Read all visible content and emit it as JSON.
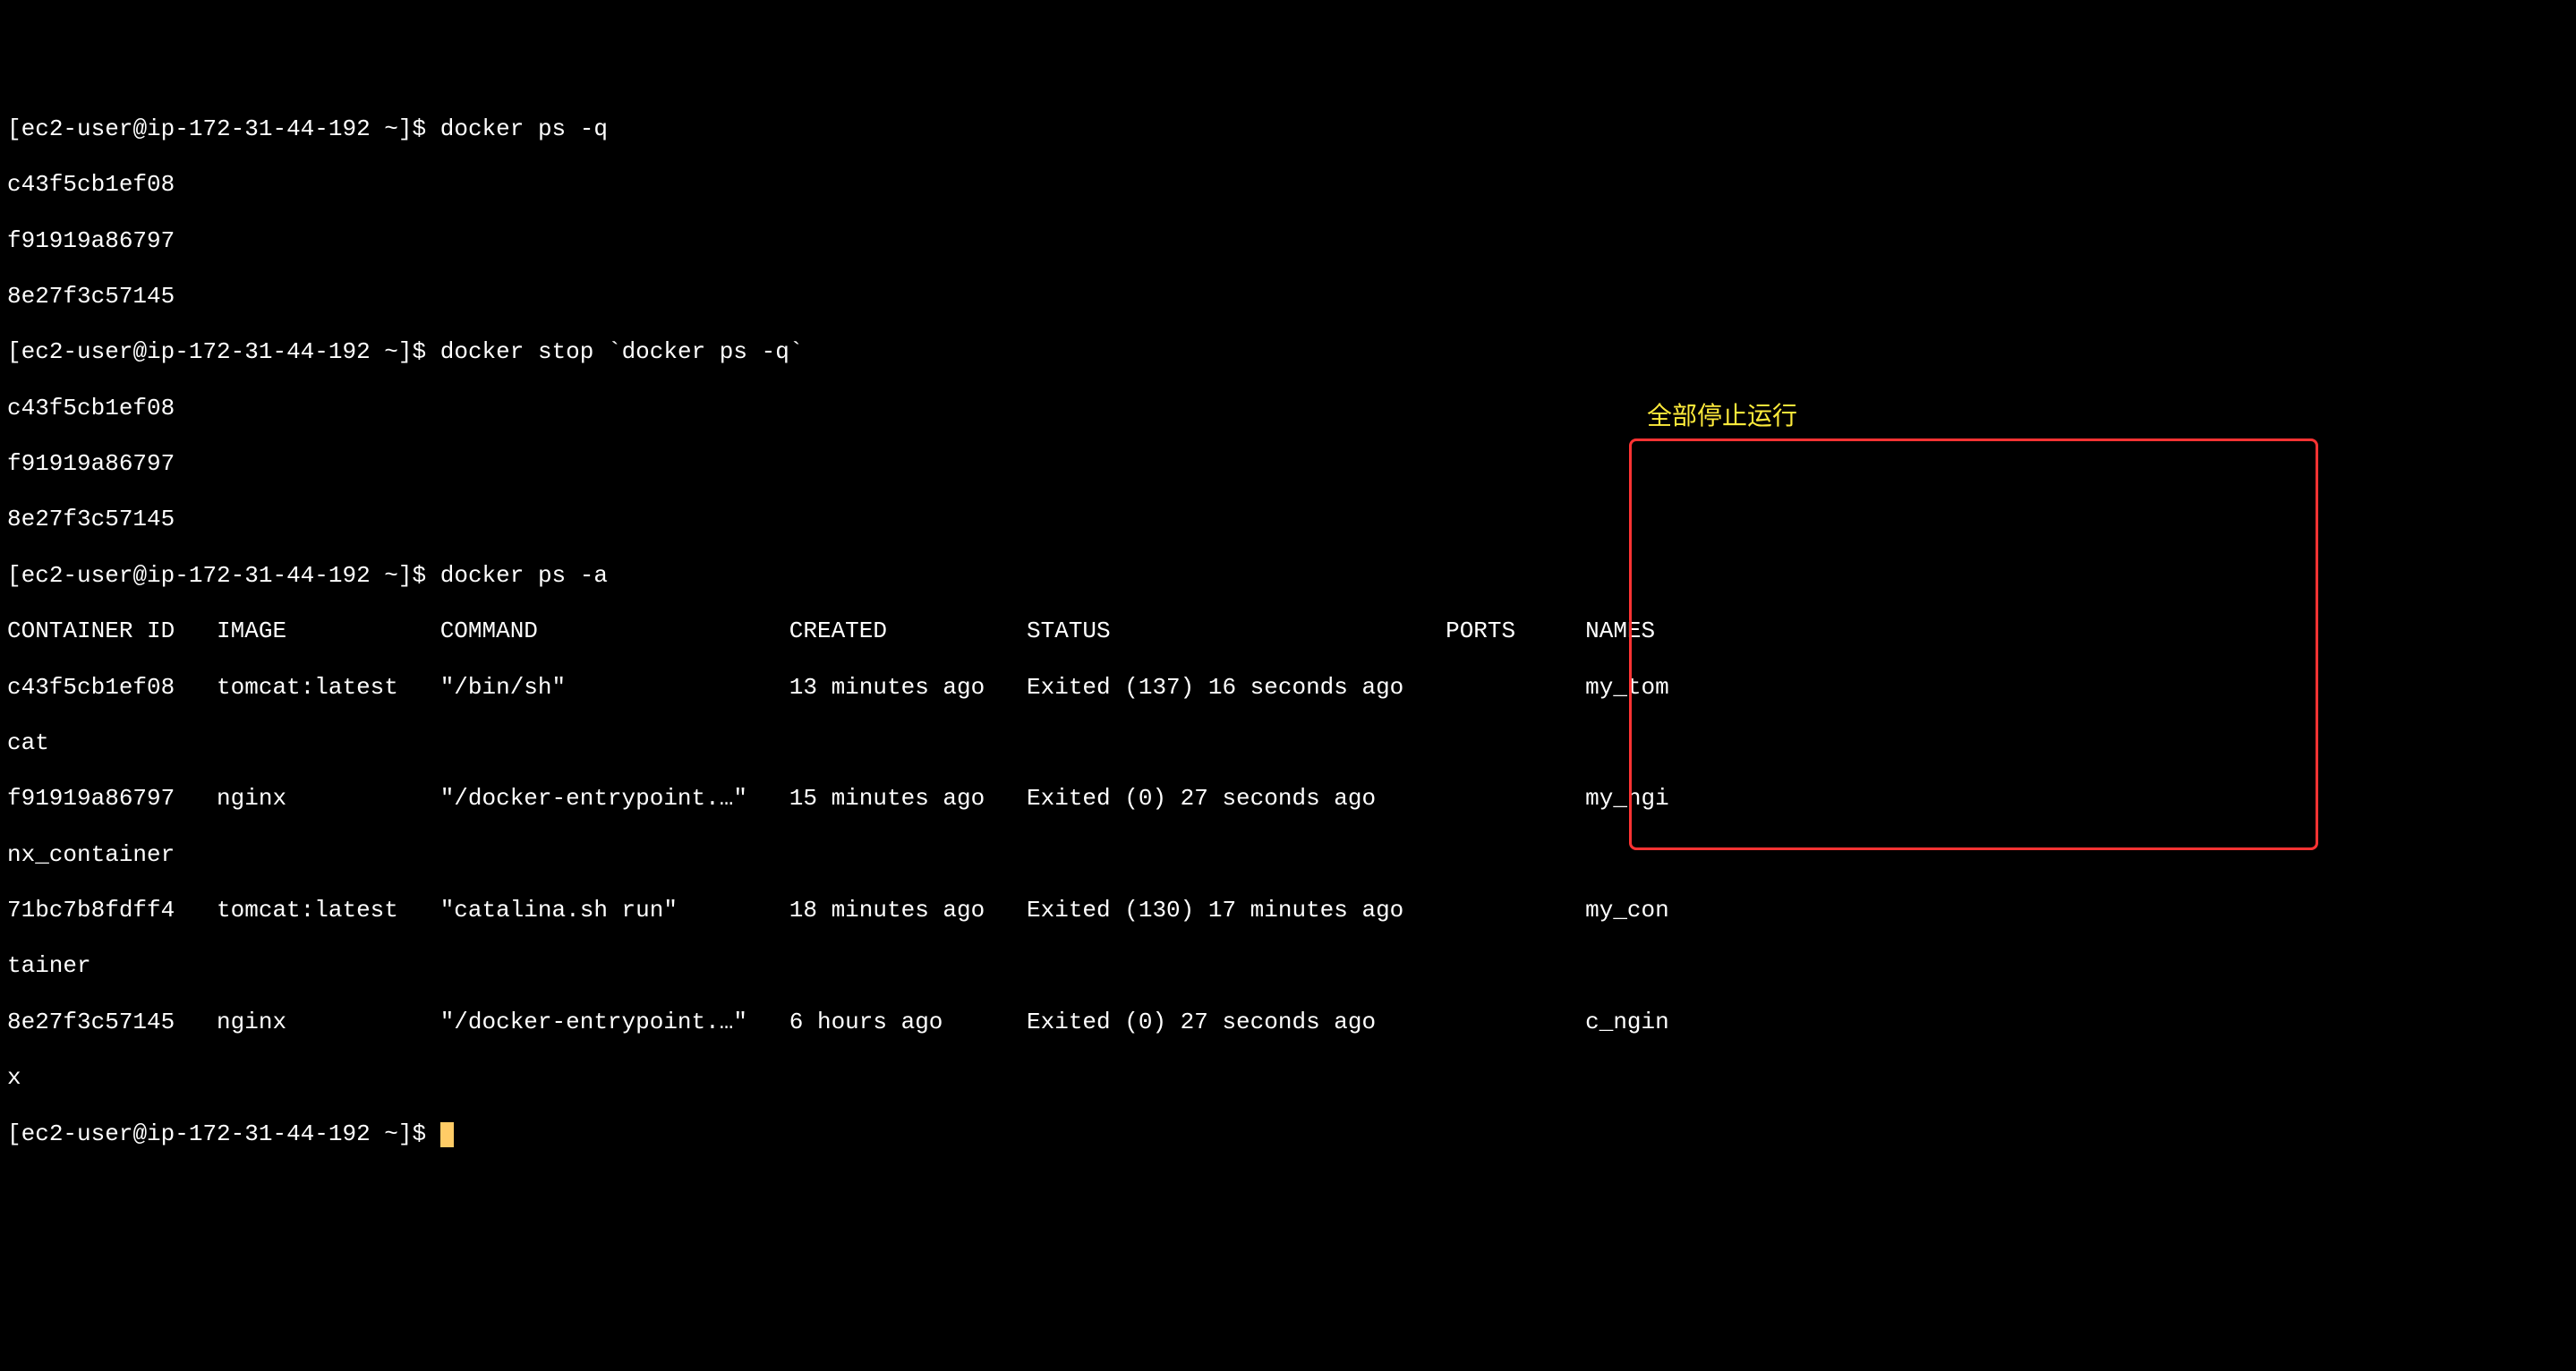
{
  "prompt": {
    "open": "[",
    "user": "ec2-user",
    "at": "@",
    "host": "ip-172-31-44-192",
    "path": " ~",
    "close": "]",
    "symbol": "$ "
  },
  "commands": {
    "cmd1": "docker ps -q",
    "cmd2": "docker stop `docker ps -q`",
    "cmd3": "docker ps -a",
    "cmd_empty": ""
  },
  "output1": {
    "line1": "c43f5cb1ef08",
    "line2": "f91919a86797",
    "line3": "8e27f3c57145"
  },
  "output2": {
    "line1": "c43f5cb1ef08",
    "line2": "f91919a86797",
    "line3": "8e27f3c57145"
  },
  "table": {
    "headers": {
      "container_id": "CONTAINER ID",
      "image": "IMAGE",
      "command": "COMMAND",
      "created": "CREATED",
      "status": "STATUS",
      "ports": "PORTS",
      "names": "NAMES"
    },
    "row1": {
      "container_id": "c43f5cb1ef08",
      "image": "tomcat:latest",
      "command": "\"/bin/sh\"",
      "created": "13 minutes ago",
      "status": "Exited (137) 16 seconds ago",
      "ports": "",
      "names_part1": "my_tom",
      "names_part2": "cat"
    },
    "row2": {
      "container_id": "f91919a86797",
      "image": "nginx",
      "command": "\"/docker-entrypoint.…\"",
      "created": "15 minutes ago",
      "status": "Exited (0) 27 seconds ago",
      "ports": "",
      "names_part1": "my_ngi",
      "names_part2": "nx_container"
    },
    "row3": {
      "container_id": "71bc7b8fdff4",
      "image": "tomcat:latest",
      "command": "\"catalina.sh run\"",
      "created": "18 minutes ago",
      "status": "Exited (130) 17 minutes ago",
      "ports": "",
      "names_part1": "my_con",
      "names_part2": "tainer"
    },
    "row4": {
      "container_id": "8e27f3c57145",
      "image": "nginx",
      "command": "\"/docker-entrypoint.…\"",
      "created": "6 hours ago",
      "status": "Exited (0) 27 seconds ago",
      "ports": "",
      "names_part1": "c_ngin",
      "names_part2": "x"
    }
  },
  "annotation": {
    "text": "全部停止运行"
  },
  "spacing": {
    "col1_pad": "   ",
    "col_image_start": "   ",
    "col_command_start": "  ",
    "col_created_start": "   ",
    "col_status_start": "   ",
    "col_ports_start": "   ",
    "col_names_start": "     "
  }
}
